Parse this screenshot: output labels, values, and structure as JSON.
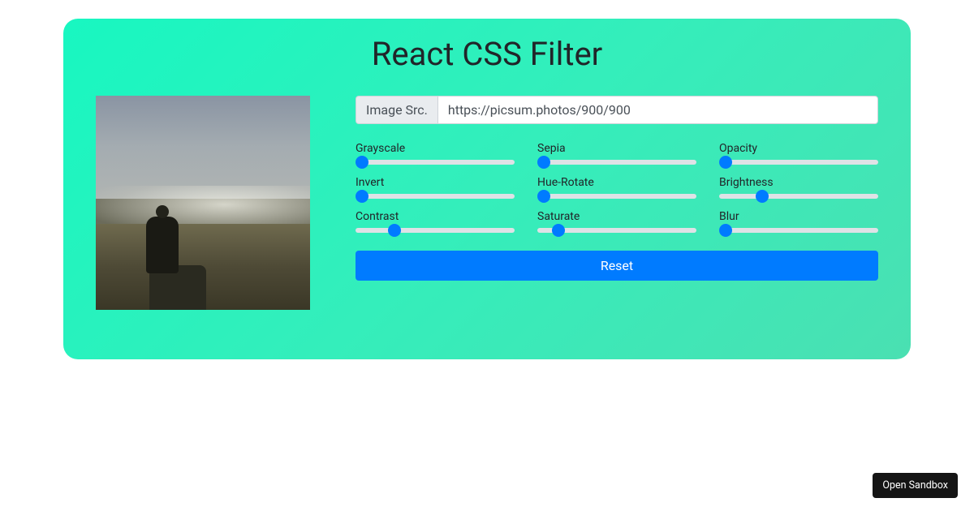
{
  "title": "React CSS Filter",
  "imageInput": {
    "label": "Image Src.",
    "value": "https://picsum.photos/900/900"
  },
  "sliders": [
    {
      "label": "Grayscale",
      "value": 0,
      "min": 0,
      "max": 100
    },
    {
      "label": "Sepia",
      "value": 0,
      "min": 0,
      "max": 100
    },
    {
      "label": "Opacity",
      "value": 0,
      "min": 0,
      "max": 100
    },
    {
      "label": "Invert",
      "value": 0,
      "min": 0,
      "max": 100
    },
    {
      "label": "Hue-Rotate",
      "value": 0,
      "min": 0,
      "max": 100
    },
    {
      "label": "Brightness",
      "value": 25,
      "min": 0,
      "max": 100
    },
    {
      "label": "Contrast",
      "value": 22,
      "min": 0,
      "max": 100
    },
    {
      "label": "Saturate",
      "value": 10,
      "min": 0,
      "max": 100
    },
    {
      "label": "Blur",
      "value": 0,
      "min": 0,
      "max": 100
    }
  ],
  "resetLabel": "Reset",
  "sandboxLabel": "Open Sandbox"
}
